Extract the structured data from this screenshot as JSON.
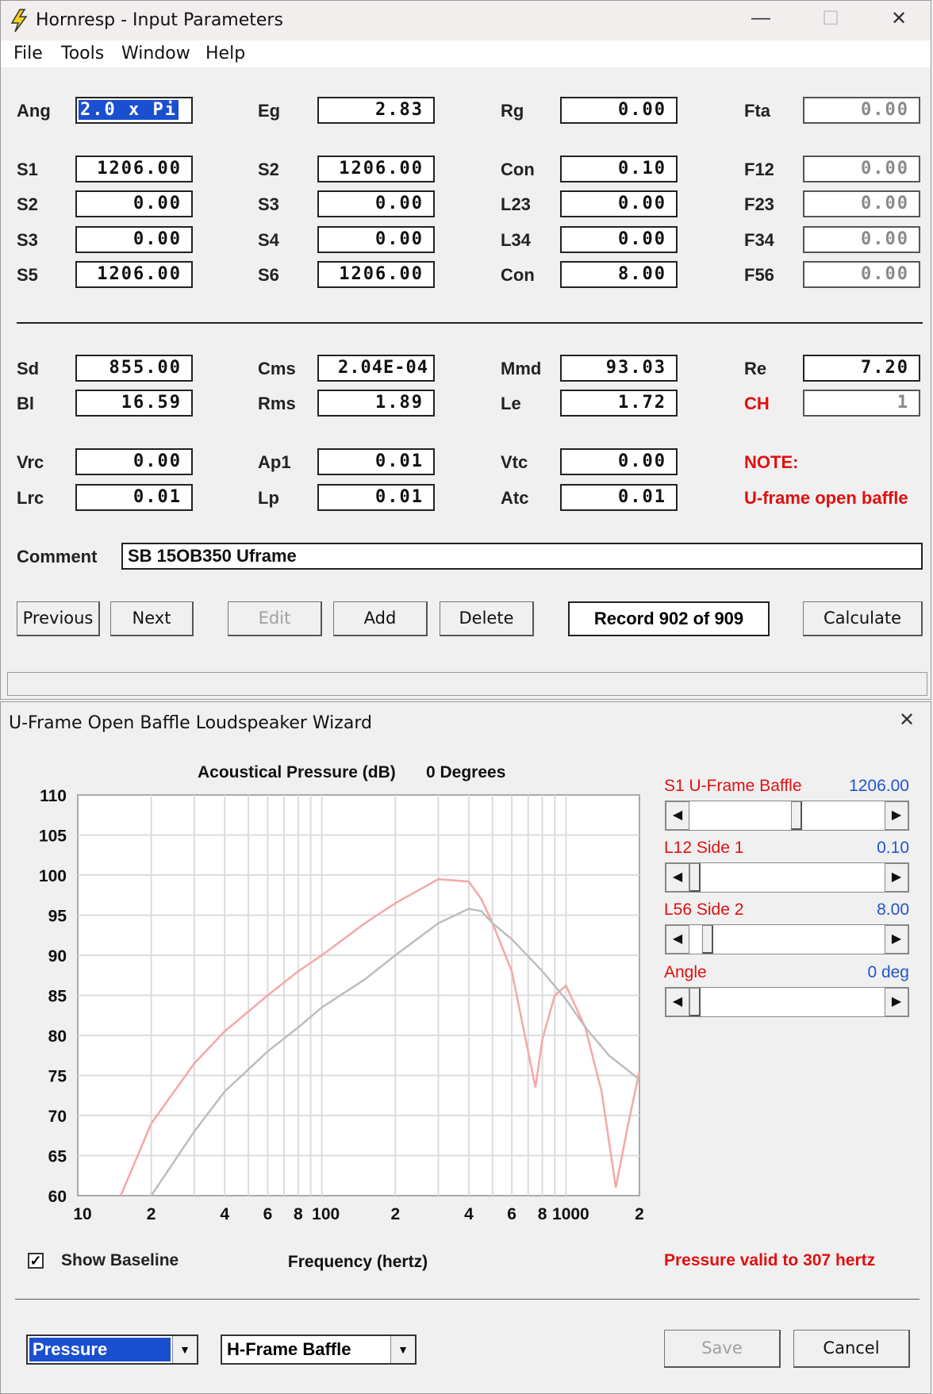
{
  "window1": {
    "title": "Hornresp - Input Parameters",
    "menu": [
      "File",
      "Tools",
      "Window",
      "Help"
    ],
    "fields": {
      "Ang": "2.0 x Pi",
      "Eg": "2.83",
      "Rg": "0.00",
      "Fta": "0.00",
      "S1": "1206.00",
      "S2a": "1206.00",
      "Con1": "0.10",
      "F12": "0.00",
      "S2": "0.00",
      "S3a": "0.00",
      "L23": "0.00",
      "F23": "0.00",
      "S3": "0.00",
      "S4": "0.00",
      "L34": "0.00",
      "F34": "0.00",
      "S5": "1206.00",
      "S6": "1206.00",
      "Con2": "8.00",
      "F56": "0.00",
      "Sd": "855.00",
      "Cms": "2.04E-04",
      "Mmd": "93.03",
      "Re": "7.20",
      "Bl": "16.59",
      "Rms": "1.89",
      "Le": "1.72",
      "CH": "1",
      "Vrc": "0.00",
      "Ap1": "0.01",
      "Vtc": "0.00",
      "Lrc": "0.01",
      "Lp": "0.01",
      "Atc": "0.01"
    },
    "labels": {
      "Ang": "Ang",
      "Eg": "Eg",
      "Rg": "Rg",
      "Fta": "Fta",
      "S1": "S1",
      "S2a": "S2",
      "Con1": "Con",
      "F12": "F12",
      "S2": "S2",
      "S3a": "S3",
      "L23": "L23",
      "F23": "F23",
      "S3": "S3",
      "S4": "S4",
      "L34": "L34",
      "F34": "F34",
      "S5": "S5",
      "S6": "S6",
      "Con2": "Con",
      "F56": "F56",
      "Sd": "Sd",
      "Cms": "Cms",
      "Mmd": "Mmd",
      "Re": "Re",
      "Bl": "Bl",
      "Rms": "Rms",
      "Le": "Le",
      "CH": "CH",
      "Vrc": "Vrc",
      "Ap1": "Ap1",
      "Vtc": "Vtc",
      "NOTE": "NOTE:",
      "Lrc": "Lrc",
      "Lp": "Lp",
      "Atc": "Atc",
      "note_text": "U-frame open baffle",
      "Comment": "Comment"
    },
    "comment_value": "SB 15OB350 Uframe",
    "buttons": {
      "previous": "Previous",
      "next": "Next",
      "edit": "Edit",
      "add": "Add",
      "delete": "Delete",
      "calculate": "Calculate"
    },
    "record": "Record 902 of 909"
  },
  "window2": {
    "title": "U-Frame Open Baffle Loudspeaker Wizard",
    "sliders": [
      {
        "label": "S1  U-Frame Baffle",
        "value": "1206.00",
        "position": 0.55
      },
      {
        "label": "L12  Side 1",
        "value": "0.10",
        "position": 0.0
      },
      {
        "label": "L56  Side 2",
        "value": "8.00",
        "position": 0.07
      },
      {
        "label": "Angle",
        "value": "0 deg",
        "position": 0.0
      }
    ],
    "show_baseline": "Show Baseline",
    "pressure_note": "Pressure valid to 307 hertz",
    "combo1": "Pressure",
    "combo2": "H-Frame Baffle",
    "save": "Save",
    "cancel": "Cancel"
  },
  "chart_data": {
    "type": "line",
    "title": "Acoustical Pressure (dB)",
    "subtitle": "0 Degrees",
    "xlabel": "Frequency (hertz)",
    "x_scale": "log",
    "xlim": [
      10,
      2000
    ],
    "ylim": [
      60,
      110
    ],
    "y_ticks": [
      "110",
      "105",
      "100",
      "95",
      "90",
      "85",
      "80",
      "75",
      "70",
      "65",
      "60"
    ],
    "x_ticks": [
      "10",
      "2",
      "4",
      "6",
      "8",
      "100",
      "2",
      "4",
      "6",
      "8",
      "1000",
      "2"
    ],
    "series": [
      {
        "color": "#f4a8a8",
        "x": [
          15,
          20,
          30,
          40,
          60,
          80,
          100,
          150,
          200,
          300,
          400,
          450,
          500,
          600,
          700,
          750,
          800,
          900,
          1000,
          1200,
          1400,
          1600,
          1800,
          2000
        ],
        "y": [
          60,
          69,
          76.5,
          80.5,
          85,
          88,
          90,
          94,
          96.5,
          99.5,
          99.2,
          97,
          94,
          88,
          78,
          73.5,
          79.5,
          85,
          86.2,
          81,
          73,
          61,
          69,
          75.5
        ]
      },
      {
        "color": "#bdbdbd",
        "x": [
          20,
          30,
          40,
          60,
          80,
          100,
          150,
          200,
          300,
          400,
          450,
          500,
          600,
          800,
          1000,
          1200,
          1500,
          2000
        ],
        "y": [
          60,
          68,
          73,
          78,
          81,
          83.5,
          87,
          90,
          94,
          95.8,
          95.5,
          94,
          92,
          88,
          84.5,
          81,
          77.5,
          74.5
        ]
      }
    ]
  }
}
